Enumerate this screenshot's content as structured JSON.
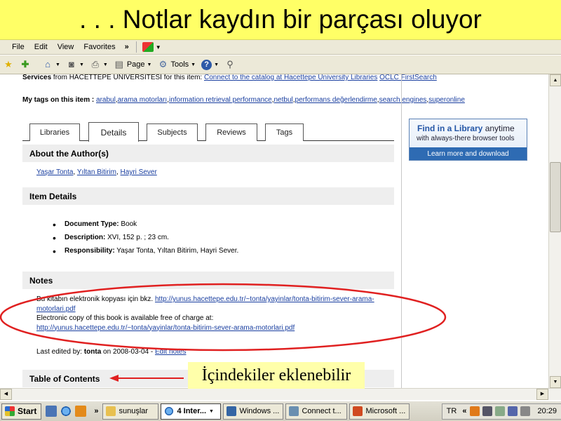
{
  "slide": {
    "title": ". . . Notlar kaydın bir parçası oluyor"
  },
  "menubar": {
    "items": [
      "File",
      "Edit",
      "View",
      "Favorites"
    ],
    "more": "»"
  },
  "cmdbar": {
    "page_label": "Page",
    "tools_label": "Tools"
  },
  "page": {
    "services": {
      "label": "Services",
      "prefix": " from HACETTEPE UNIVERSITESI for this item: ",
      "link1": "Connect to the catalog at Hacettepe University Libraries",
      "link2": "OCLC FirstSearch"
    },
    "mytags": {
      "label": "My tags on this item : ",
      "tags": [
        "arabul",
        "arama motorları",
        "information retrieval performance",
        "netbul",
        "performans değerlendirme",
        "search engines",
        "superonline"
      ]
    },
    "tabs": [
      "Libraries",
      "Details",
      "Subjects",
      "Reviews",
      "Tags"
    ],
    "active_tab": "Details",
    "about_author": {
      "heading": "About the Author(s)",
      "authors": [
        "Yaşar Tonta",
        "Yıltan Bitirim",
        "Hayri Sever"
      ]
    },
    "item_details": {
      "heading": "Item Details",
      "rows": [
        {
          "label": "Document Type:",
          "value": " Book"
        },
        {
          "label": "Description:",
          "value": " XVI, 152 p. ; 23 cm."
        },
        {
          "label": "Responsibility:",
          "value": " Yaşar Tonta, Yıltan Bitirim, Hayri Sever."
        }
      ]
    },
    "notes": {
      "heading": "Notes",
      "line1_text": "Bu kitabın elektronik kopyası için bkz. ",
      "line1_link": "http://yunus.hacettepe.edu.tr/~tonta/yayinlar/tonta-bitirim-sever-arama-motorlari.pdf",
      "line2_text": "Electronic copy of this book is available free of charge at:",
      "line2_link": "http://yunus.hacettepe.edu.tr/~tonta/yayinlar/tonta-bitirim-sever-arama-motorlari.pdf",
      "last_edited_prefix": "Last edited by: ",
      "last_edited_user": "tonta",
      "last_edited_date": " on 2008-03-04 - ",
      "edit_link": "Edit notes"
    },
    "toc": {
      "heading": "Table of Contents"
    },
    "ad": {
      "title_bold": "Find in a Library",
      "title_rest": " anytime",
      "subtitle": "with always-there browser tools",
      "button": "Learn more and download"
    }
  },
  "callout": {
    "text": "İçindekiler eklenebilir"
  },
  "taskbar": {
    "start": "Start",
    "tasks": [
      "sunuşlar",
      "4 Inter...",
      "Windows ...",
      "Connect t...",
      "Microsoft ..."
    ],
    "active_task": "4 Inter...",
    "lang": "TR",
    "clock": "20:29"
  },
  "colors": {
    "slide_title_bg": "#ffff66",
    "link": "#1a3fa0",
    "ellipse": "#e02020",
    "callout_bg": "#ffffaa"
  }
}
